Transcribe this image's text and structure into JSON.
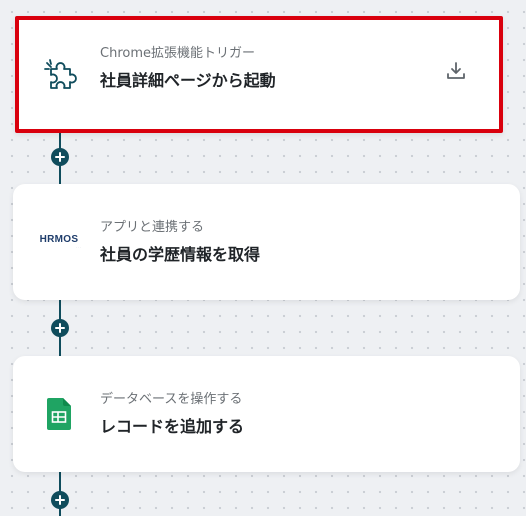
{
  "colors": {
    "accent": "#0f4c5c",
    "selection": "#d9000d",
    "sheets_green": "#1fa463"
  },
  "flow": {
    "steps": [
      {
        "subtitle": "Chrome拡張機能トリガー",
        "title": "社員詳細ページから起動",
        "icon": "puzzle-icon",
        "action_icon": "download-icon"
      },
      {
        "subtitle": "アプリと連携する",
        "title": "社員の学歴情報を取得",
        "icon": "hrmos-logo",
        "logo_text": "HRMOS"
      },
      {
        "subtitle": "データベースを操作する",
        "title": "レコードを追加する",
        "icon": "google-sheets-icon"
      }
    ],
    "add_step_icon": "plus-icon"
  }
}
